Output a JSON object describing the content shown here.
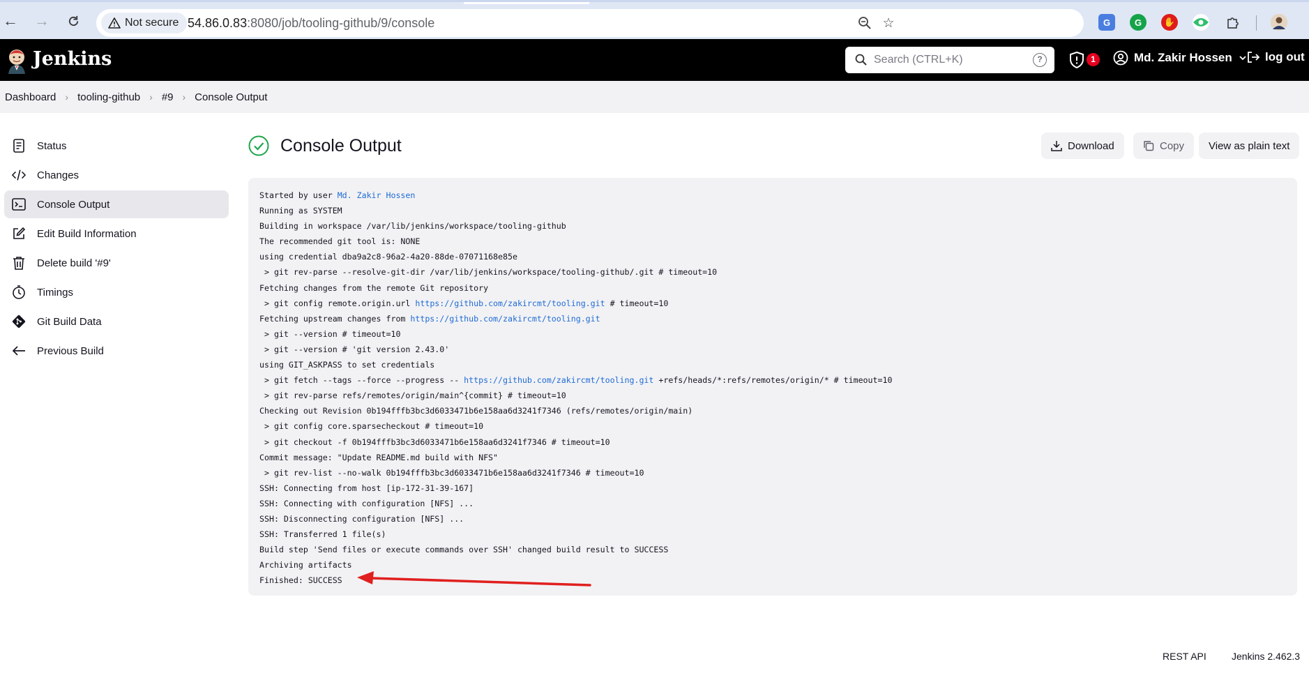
{
  "browser": {
    "security_label": "Not secure",
    "url_host": "54.86.0.83",
    "url_rest": ":8080/job/tooling-github/9/console"
  },
  "header": {
    "app_name": "Jenkins",
    "search_placeholder": "Search (CTRL+K)",
    "search_help": "?",
    "alerts_count": "1",
    "user_name": "Md. Zakir Hossen",
    "logout_label": "log out"
  },
  "breadcrumb": [
    "Dashboard",
    "tooling-github",
    "#9",
    "Console Output"
  ],
  "sidebar": {
    "items": [
      {
        "label": "Status",
        "icon": "document-icon"
      },
      {
        "label": "Changes",
        "icon": "code-icon"
      },
      {
        "label": "Console Output",
        "icon": "terminal-icon",
        "active": true
      },
      {
        "label": "Edit Build Information",
        "icon": "edit-icon"
      },
      {
        "label": "Delete build '#9'",
        "icon": "trash-icon"
      },
      {
        "label": "Timings",
        "icon": "clock-icon"
      },
      {
        "label": "Git Build Data",
        "icon": "git-icon"
      },
      {
        "label": "Previous Build",
        "icon": "arrow-left-icon"
      }
    ]
  },
  "main": {
    "title": "Console Output",
    "status": "success",
    "download_label": "Download",
    "copy_label": "Copy",
    "plain_text_label": "View as plain text"
  },
  "console": {
    "lines": [
      [
        {
          "t": "Started by user "
        },
        {
          "t": "Md. Zakir Hossen",
          "link": true
        }
      ],
      [
        {
          "t": "Running as SYSTEM"
        }
      ],
      [
        {
          "t": "Building in workspace /var/lib/jenkins/workspace/tooling-github"
        }
      ],
      [
        {
          "t": "The recommended git tool is: NONE"
        }
      ],
      [
        {
          "t": "using credential dba9a2c8-96a2-4a20-88de-07071168e85e"
        }
      ],
      [
        {
          "t": " > git rev-parse --resolve-git-dir /var/lib/jenkins/workspace/tooling-github/.git # timeout=10"
        }
      ],
      [
        {
          "t": "Fetching changes from the remote Git repository"
        }
      ],
      [
        {
          "t": " > git config remote.origin.url "
        },
        {
          "t": "https://github.com/zakircmt/tooling.git",
          "link": true
        },
        {
          "t": " # timeout=10"
        }
      ],
      [
        {
          "t": "Fetching upstream changes from "
        },
        {
          "t": "https://github.com/zakircmt/tooling.git",
          "link": true
        }
      ],
      [
        {
          "t": " > git --version # timeout=10"
        }
      ],
      [
        {
          "t": " > git --version # 'git version 2.43.0'"
        }
      ],
      [
        {
          "t": "using GIT_ASKPASS to set credentials"
        }
      ],
      [
        {
          "t": " > git fetch --tags --force --progress -- "
        },
        {
          "t": "https://github.com/zakircmt/tooling.git",
          "link": true
        },
        {
          "t": " +refs/heads/*:refs/remotes/origin/* # timeout=10"
        }
      ],
      [
        {
          "t": " > git rev-parse refs/remotes/origin/main^{commit} # timeout=10"
        }
      ],
      [
        {
          "t": "Checking out Revision 0b194fffb3bc3d6033471b6e158aa6d3241f7346 (refs/remotes/origin/main)"
        }
      ],
      [
        {
          "t": " > git config core.sparsecheckout # timeout=10"
        }
      ],
      [
        {
          "t": " > git checkout -f 0b194fffb3bc3d6033471b6e158aa6d3241f7346 # timeout=10"
        }
      ],
      [
        {
          "t": "Commit message: \"Update README.md build with NFS\""
        }
      ],
      [
        {
          "t": " > git rev-list --no-walk 0b194fffb3bc3d6033471b6e158aa6d3241f7346 # timeout=10"
        }
      ],
      [
        {
          "t": "SSH: Connecting from host [ip-172-31-39-167]"
        }
      ],
      [
        {
          "t": "SSH: Connecting with configuration [NFS] ..."
        }
      ],
      [
        {
          "t": "SSH: Disconnecting configuration [NFS] ..."
        }
      ],
      [
        {
          "t": "SSH: Transferred 1 file(s)"
        }
      ],
      [
        {
          "t": "Build step 'Send files or execute commands over SSH' changed build result to SUCCESS"
        }
      ],
      [
        {
          "t": "Archiving artifacts"
        }
      ],
      [
        {
          "t": "Finished: SUCCESS"
        }
      ]
    ]
  },
  "footer": {
    "rest_api_label": "REST API",
    "version_label": "Jenkins 2.462.3"
  },
  "colors": {
    "success": "#1ea64b",
    "link": "#1f6bd6",
    "annotation_arrow": "#e0201f"
  }
}
